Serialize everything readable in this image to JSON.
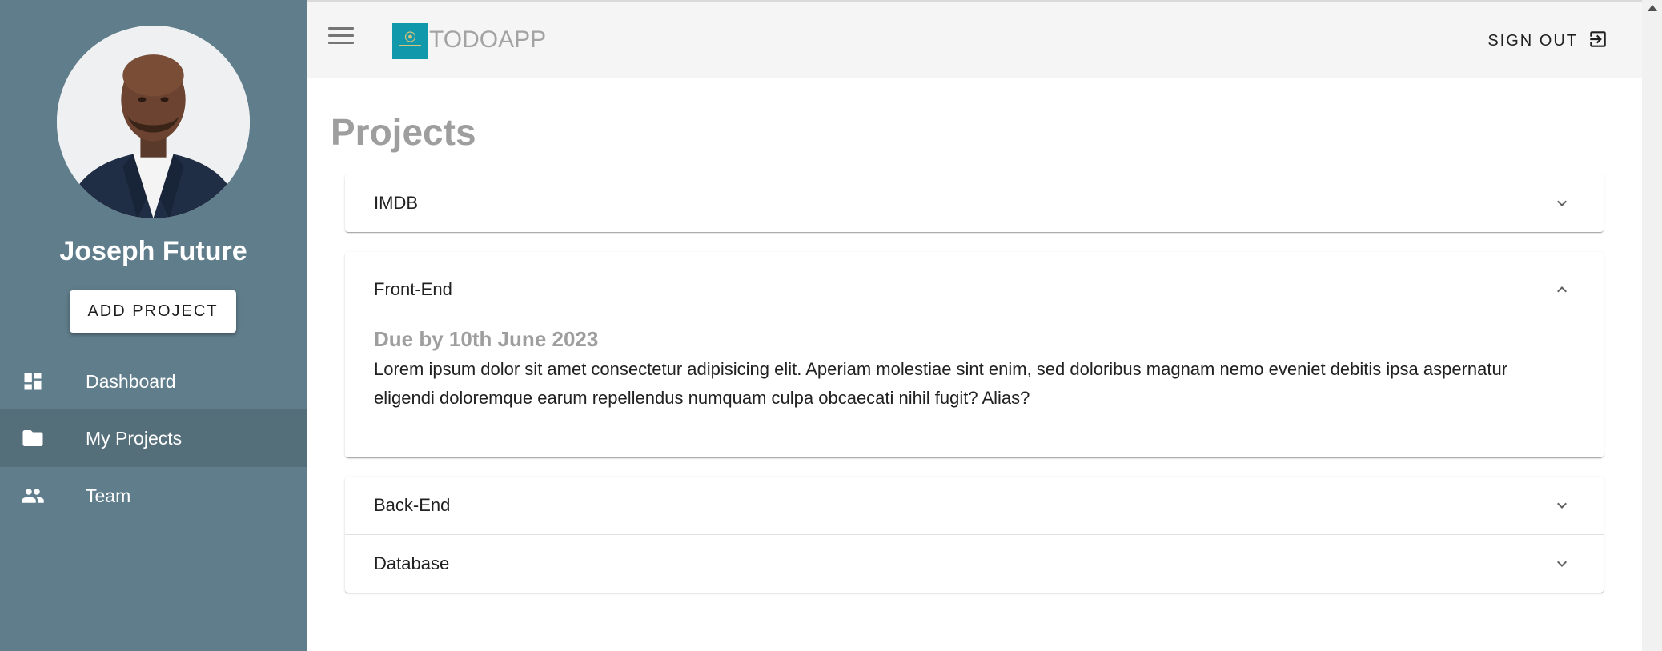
{
  "user": {
    "name": "Joseph Future"
  },
  "sidebar": {
    "add_project_label": "ADD PROJECT",
    "items": [
      {
        "label": "Dashboard",
        "icon": "dashboard-icon"
      },
      {
        "label": "My Projects",
        "icon": "folder-icon",
        "active": true
      },
      {
        "label": "Team",
        "icon": "people-icon"
      }
    ]
  },
  "topbar": {
    "app_name": "TODOAPP",
    "signout_label": "SIGN OUT"
  },
  "main": {
    "title": "Projects",
    "projects": [
      {
        "label": "IMDB",
        "expanded": false
      },
      {
        "label": "Front-End",
        "expanded": true,
        "due": "Due by 10th June 2023",
        "description": "Lorem ipsum dolor sit amet consectetur adipisicing elit. Aperiam molestiae sint enim, sed doloribus magnam nemo eveniet debitis ipsa aspernatur eligendi doloremque earum repellendus numquam culpa obcaecati nihil fugit? Alias?"
      },
      {
        "label": "Back-End",
        "expanded": false
      },
      {
        "label": "Database",
        "expanded": false
      }
    ]
  },
  "colors": {
    "sidebar_bg": "#607d8b",
    "sidebar_active": "#546e7a",
    "topbar_bg": "#f5f5f5",
    "logo_bg": "#1199ab",
    "title_gray": "#9e9e9e"
  }
}
